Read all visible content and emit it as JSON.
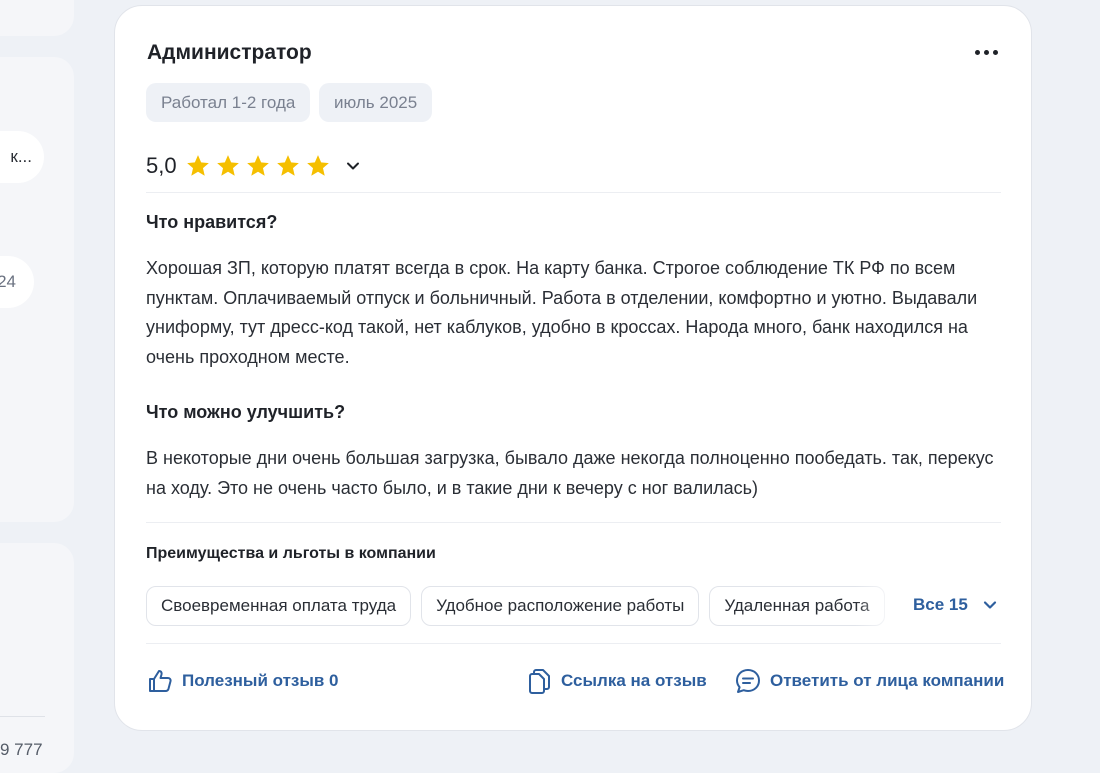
{
  "left_panel": {
    "pill1": "к...",
    "pill2": "24",
    "bottom_number": "9 777"
  },
  "review": {
    "title": "Администратор",
    "tags": [
      "Работал 1-2 года",
      "июль 2025"
    ],
    "rating": "5,0",
    "rating_value": 5,
    "rating_max": 5,
    "star_color": "#f5bf00",
    "likes_header": "Что нравится?",
    "likes_text": "Хорошая ЗП, которую платят всегда в срок. На карту банка. Строгое соблюдение ТК РФ по всем пунктам. Оплачиваемый отпуск и больничный. Работа в отделении, комфортно и уютно. Выдавали униформу, тут дресс-код такой, нет каблуков, удобно в кроссах. Народа много, банк находился на очень проходном месте.",
    "improve_header": "Что можно улучшить?",
    "improve_text": "В некоторые дни очень большая загрузка, бывало даже некогда полноценно пообедать. так, перекус на ходу. Это не очень часто было, и в такие дни к вечеру с ног валилась)",
    "benefits_header": "Преимущества и льготы в компании",
    "benefits": [
      "Своевременная оплата труда",
      "Удобное расположение работы",
      "Удаленная работа"
    ],
    "all_benefits_label": "Все 15",
    "actions": {
      "helpful": "Полезный отзыв 0",
      "link": "Ссылка на отзыв",
      "reply": "Ответить от лица компании"
    },
    "accent_color": "#2e5f9e"
  }
}
